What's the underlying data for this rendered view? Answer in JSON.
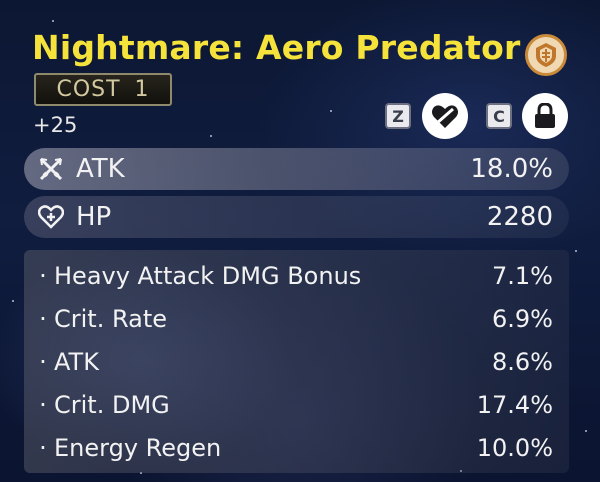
{
  "echo": {
    "name": "Nightmare: Aero Predator",
    "cost_label": "COST",
    "cost_value": "1",
    "level": "+25"
  },
  "controls": {
    "discard_key": "Z",
    "lock_key": "C",
    "discard_icon": "broken-heart-icon",
    "lock_icon": "lock-icon",
    "sonata_icon": "sonata-emblem-icon"
  },
  "main_stats": [
    {
      "icon": "crossed-swords-icon",
      "label": "ATK",
      "value": "18.0%"
    },
    {
      "icon": "heart-plus-icon",
      "label": "HP",
      "value": "2280"
    }
  ],
  "sub_stats": [
    {
      "label": "Heavy Attack DMG Bonus",
      "value": "7.1%"
    },
    {
      "label": "Crit. Rate",
      "value": "6.9%"
    },
    {
      "label": "ATK",
      "value": "8.6%"
    },
    {
      "label": "Crit. DMG",
      "value": "17.4%"
    },
    {
      "label": "Energy Regen",
      "value": "10.0%"
    }
  ],
  "colors": {
    "title": "#f5e23a",
    "sonata_ring": "#c98a3a",
    "background": "#101d3f"
  }
}
